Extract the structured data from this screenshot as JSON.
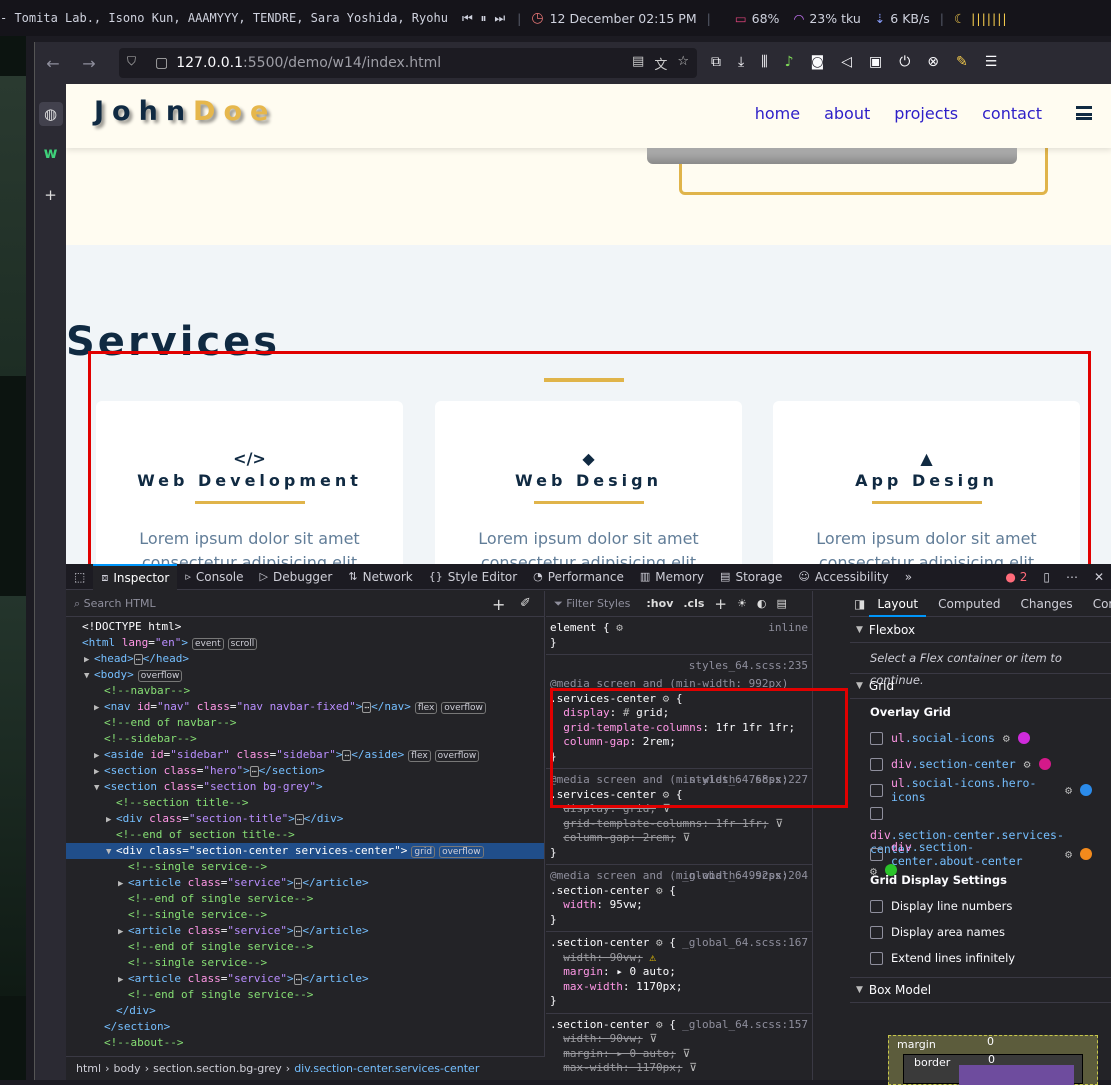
{
  "sysbar": {
    "workspaces": "- Tomita Lab., Isono Kun, AAAMYYY, TENDRE, Sara Yoshida, Ryohu",
    "datetime": "12 December 02:15 PM",
    "battery": "68%",
    "wifi": "23% tku",
    "net": "6 KB/s"
  },
  "browser": {
    "url_host": "127.0.0.1",
    "url_path": ":5500/demo/w14/index.html"
  },
  "site": {
    "logo_first": "John",
    "logo_last": "Doe",
    "nav": [
      "home",
      "about",
      "projects",
      "contact"
    ],
    "services_title": "Services",
    "cards": [
      {
        "icon": "</>",
        "title": "Web Development",
        "text": "Lorem ipsum dolor sit amet",
        "text2": "consectetur adipisicing elit"
      },
      {
        "icon": "◆",
        "title": "Web Design",
        "text": "Lorem ipsum dolor sit amet",
        "text2": "consectetur adipisicing elit"
      },
      {
        "icon": "▲",
        "title": "App Design",
        "text": "Lorem ipsum dolor sit amet",
        "text2": "consectetur adipisicing elit"
      }
    ]
  },
  "devtools": {
    "tabs": [
      "Inspector",
      "Console",
      "Debugger",
      "Network",
      "Style Editor",
      "Performance",
      "Memory",
      "Storage",
      "Accessibility"
    ],
    "error_count": "2",
    "search_placeholder": "Search HTML",
    "filter_placeholder": "Filter Styles",
    "hov": ":hov",
    "cls": ".cls",
    "layout_tabs": [
      "Layout",
      "Computed",
      "Changes",
      "Comp"
    ],
    "crumbs": [
      "html",
      "body",
      "section.section.bg-grey",
      "div.section-center.services-center"
    ],
    "flexbox_label": "Flexbox",
    "flexbox_msg": "Select a Flex container or item to continue.",
    "grid_label": "Grid",
    "overlay_grid": "Overlay Grid",
    "grid_items": [
      {
        "tag": "ul",
        "cls": ".social-icons",
        "color": "#cf2bdb"
      },
      {
        "tag": "div",
        "cls": ".section-center",
        "color": "#d4198a"
      },
      {
        "tag": "ul",
        "cls": ".social-icons.hero-icons",
        "color": "#2b8bea"
      },
      {
        "tag": "div",
        "cls": ".section-center.services-center",
        "color": "#2ac32a"
      },
      {
        "tag": "div",
        "cls": ".section-center.about-center",
        "color": "#f38a1c"
      }
    ],
    "grid_display": "Grid Display Settings",
    "settings": [
      "Display line numbers",
      "Display area names",
      "Extend lines infinitely"
    ],
    "box_model": "Box Model",
    "margin_label": "margin",
    "margin_val": "0",
    "border_label": "border",
    "border_val": "0"
  }
}
